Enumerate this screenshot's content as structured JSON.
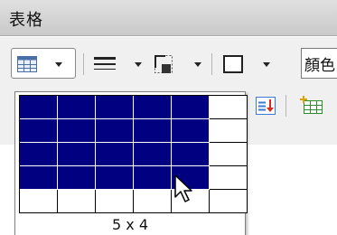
{
  "window": {
    "title": "表格"
  },
  "toolbar": {
    "color_field_value": "顏色",
    "buttons": [
      {
        "name": "insert-table",
        "icon": "table-grid-icon",
        "has_dropdown": true,
        "pressed": true
      },
      {
        "name": "border-style",
        "icon": "line-style-icon",
        "has_dropdown": true
      },
      {
        "name": "border-position",
        "icon": "border-position-icon",
        "has_dropdown": true
      },
      {
        "name": "border-box",
        "icon": "border-box-icon",
        "has_dropdown": true
      },
      {
        "name": "sort",
        "icon": "sort-icon",
        "has_dropdown": false
      },
      {
        "name": "insert-rows",
        "icon": "insert-rows-icon",
        "has_dropdown": false
      }
    ]
  },
  "table_picker": {
    "columns": 6,
    "rows": 5,
    "selected_columns": 5,
    "selected_rows": 4,
    "size_label": "5 x 4",
    "selected_color": "#000080"
  }
}
